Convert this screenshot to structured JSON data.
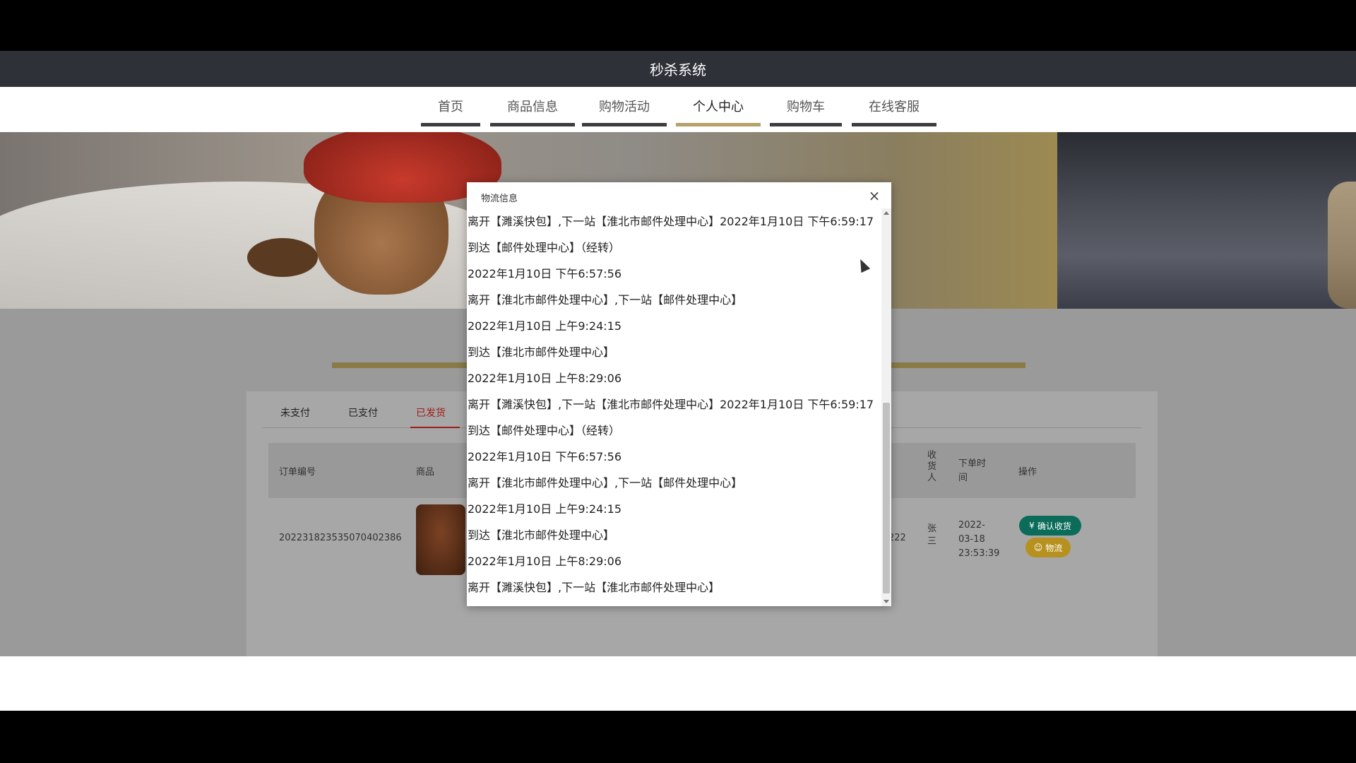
{
  "header": {
    "title": "秒杀系统"
  },
  "nav": {
    "items": [
      {
        "label": "首页"
      },
      {
        "label": "商品信息"
      },
      {
        "label": "购物活动"
      },
      {
        "label": "个人中心"
      },
      {
        "label": "购物车"
      },
      {
        "label": "在线客服"
      }
    ],
    "active": "个人中心"
  },
  "orders": {
    "tabs": [
      {
        "label": "未支付"
      },
      {
        "label": "已支付"
      },
      {
        "label": "已发货"
      }
    ],
    "active_tab": "已发货",
    "columns": {
      "order_no": "订单编号",
      "product": "商品",
      "receiver": "收\n货\n人",
      "order_time": "下单时\n间",
      "actions": "操作"
    },
    "row": {
      "order_no": "20223182353507040238​6",
      "phone_fragment": "222",
      "receiver": "张\n三",
      "order_time": "2022-\n03-18\n23:53:39",
      "confirm_label": "确认收货",
      "logistics_label": "物流"
    }
  },
  "modal": {
    "title": "物流信息",
    "close_symbol": "×",
    "lines": [
      "离开【濉溪快包】,下一站【淮北市邮件处理中心】2022年1月10日 下午6:59:17",
      "到达【邮件处理中心】（经转）",
      "2022年1月10日 下午6:57:56",
      "离开【淮北市邮件处理中心】,下一站【邮件处理中心】",
      "2022年1月10日 上午9:24:15",
      "到达【淮北市邮件处理中心】",
      "2022年1月10日 上午8:29:06",
      "离开【濉溪快包】,下一站【淮北市邮件处理中心】2022年1月10日 下午6:59:17",
      "到达【邮件处理中心】（经转）",
      "2022年1月10日 下午6:57:56",
      "离开【淮北市邮件处理中心】,下一站【邮件处理中心】",
      "2022年1月10日 上午9:24:15",
      "到达【淮北市邮件处理中心】",
      "2022年1月10日 上午8:29:06",
      "离开【濉溪快包】,下一站【淮北市邮件处理中心】"
    ]
  },
  "colors": {
    "header_bg": "#2e3138",
    "nav_active_underline": "#b5a16a",
    "tab_active": "#9b1e16",
    "confirm_button": "#0b6c5a",
    "logistics_button": "#b7911f"
  }
}
